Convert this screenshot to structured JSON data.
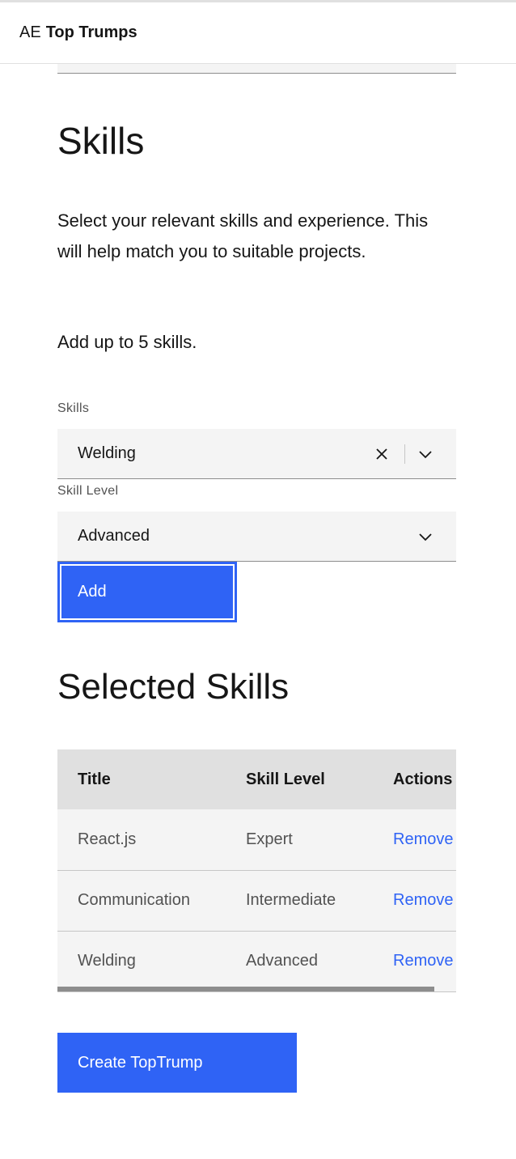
{
  "header": {
    "brand_prefix": "AE",
    "brand_name": "Top Trumps"
  },
  "skills_section": {
    "title": "Skills",
    "intro": "Select your relevant skills and experience. This will help match you to suitable projects.",
    "limit_note": "Add up to 5 skills."
  },
  "skills_field": {
    "label": "Skills",
    "value": "Welding",
    "icons": [
      "close-icon",
      "chevron-down-icon"
    ]
  },
  "level_field": {
    "label": "Skill Level",
    "value": "Advanced",
    "icons": [
      "chevron-down-icon"
    ]
  },
  "add_button": {
    "label": "Add"
  },
  "selected_section": {
    "title": "Selected Skills"
  },
  "table": {
    "columns": [
      "Title",
      "Skill Level",
      "Actions"
    ],
    "rows": [
      {
        "title": "React.js",
        "level": "Expert",
        "action": "Remove"
      },
      {
        "title": "Communication",
        "level": "Intermediate",
        "action": "Remove"
      },
      {
        "title": "Welding",
        "level": "Advanced",
        "action": "Remove"
      }
    ]
  },
  "create_button": {
    "label": "Create TopTrump"
  },
  "colors": {
    "primary": "#2f63f5",
    "field_bg": "#f4f4f4",
    "header_row_bg": "#e0e0e0",
    "text": "#161616"
  }
}
